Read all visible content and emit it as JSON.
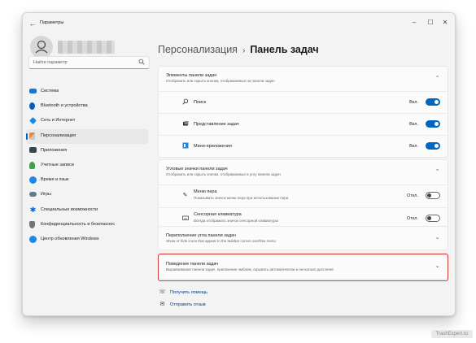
{
  "window": {
    "title": "Параметры",
    "back": "←",
    "minimize": "–",
    "maximize": "☐",
    "close": "✕"
  },
  "profile": {
    "avatar_glyph": "&#9711;"
  },
  "search": {
    "placeholder": "Найти параметр",
    "icon": "search-icon"
  },
  "sidebar": {
    "items": [
      {
        "label": "Система",
        "icon": "monitor-icon",
        "color": "#1976d2"
      },
      {
        "label": "Bluetooth и устройства",
        "icon": "bluetooth-icon",
        "color": "#0a5fb4"
      },
      {
        "label": "Сеть и Интернет",
        "icon": "network-icon",
        "color": "#1e88e5"
      },
      {
        "label": "Персонализация",
        "icon": "brush-icon",
        "color": "#e6893b",
        "active": true
      },
      {
        "label": "Приложения",
        "icon": "apps-icon",
        "color": "#37474f"
      },
      {
        "label": "Учетные записи",
        "icon": "accounts-icon",
        "color": "#43a047"
      },
      {
        "label": "Время и язык",
        "icon": "globe-icon",
        "color": "#1e88e5"
      },
      {
        "label": "Игры",
        "icon": "gamepad-icon",
        "color": "#607d8b"
      },
      {
        "label": "Специальные возможности",
        "icon": "accessibility-icon",
        "color": "#1565c0"
      },
      {
        "label": "Конфиденциальность и безопаснос",
        "icon": "shield-icon",
        "color": "#757575"
      },
      {
        "label": "Центр обновления Windows",
        "icon": "update-icon",
        "color": "#1e88e5"
      }
    ]
  },
  "breadcrumb": {
    "parent": "Персонализация",
    "separator": "›",
    "current": "Панель задач"
  },
  "cards": {
    "taskbar_items": {
      "title": "Элементы панели задач",
      "subtitle": "Отобразить или скрыть кнопки, отображаемые на панели задач",
      "rows": [
        {
          "label": "Поиск",
          "state": "Вкл.",
          "on": true,
          "icon": "search-icon"
        },
        {
          "label": "Представление задач",
          "state": "Вкл.",
          "on": true,
          "icon": "task-view-icon"
        },
        {
          "label": "Мини-приложения",
          "state": "Вкл.",
          "on": true,
          "icon": "widgets-icon"
        }
      ]
    },
    "corner_icons": {
      "title": "Угловые значки панели задач",
      "subtitle": "Отобразить или скрыть значки, отображаемые в углу панели задач",
      "rows": [
        {
          "label": "Меню пера",
          "desc": "Показывать значок меню пера при использовании пера",
          "state": "Откл.",
          "on": false,
          "icon": "pen-icon"
        },
        {
          "label": "Сенсорная клавиатура",
          "desc": "Всегда отображать значок сенсорной клавиатуры",
          "state": "Откл.",
          "on": false,
          "icon": "keyboard-icon"
        }
      ]
    },
    "overflow": {
      "title": "Переполнение угла панели задач",
      "subtitle": "Show or hide icons that appear in the taskbar corner overflow menu"
    },
    "behaviors": {
      "title": "Поведение панели задач",
      "subtitle": "Выравнивание панели задач, присвоение эмблем, скрывать автоматически и несколько дисплеев"
    }
  },
  "links": {
    "help": "Получить помощь",
    "feedback": "Отправить отзыв"
  },
  "watermark": "TrashExpert.ru",
  "colors": {
    "accent": "#0067c0",
    "highlight": "#d33a3a"
  }
}
